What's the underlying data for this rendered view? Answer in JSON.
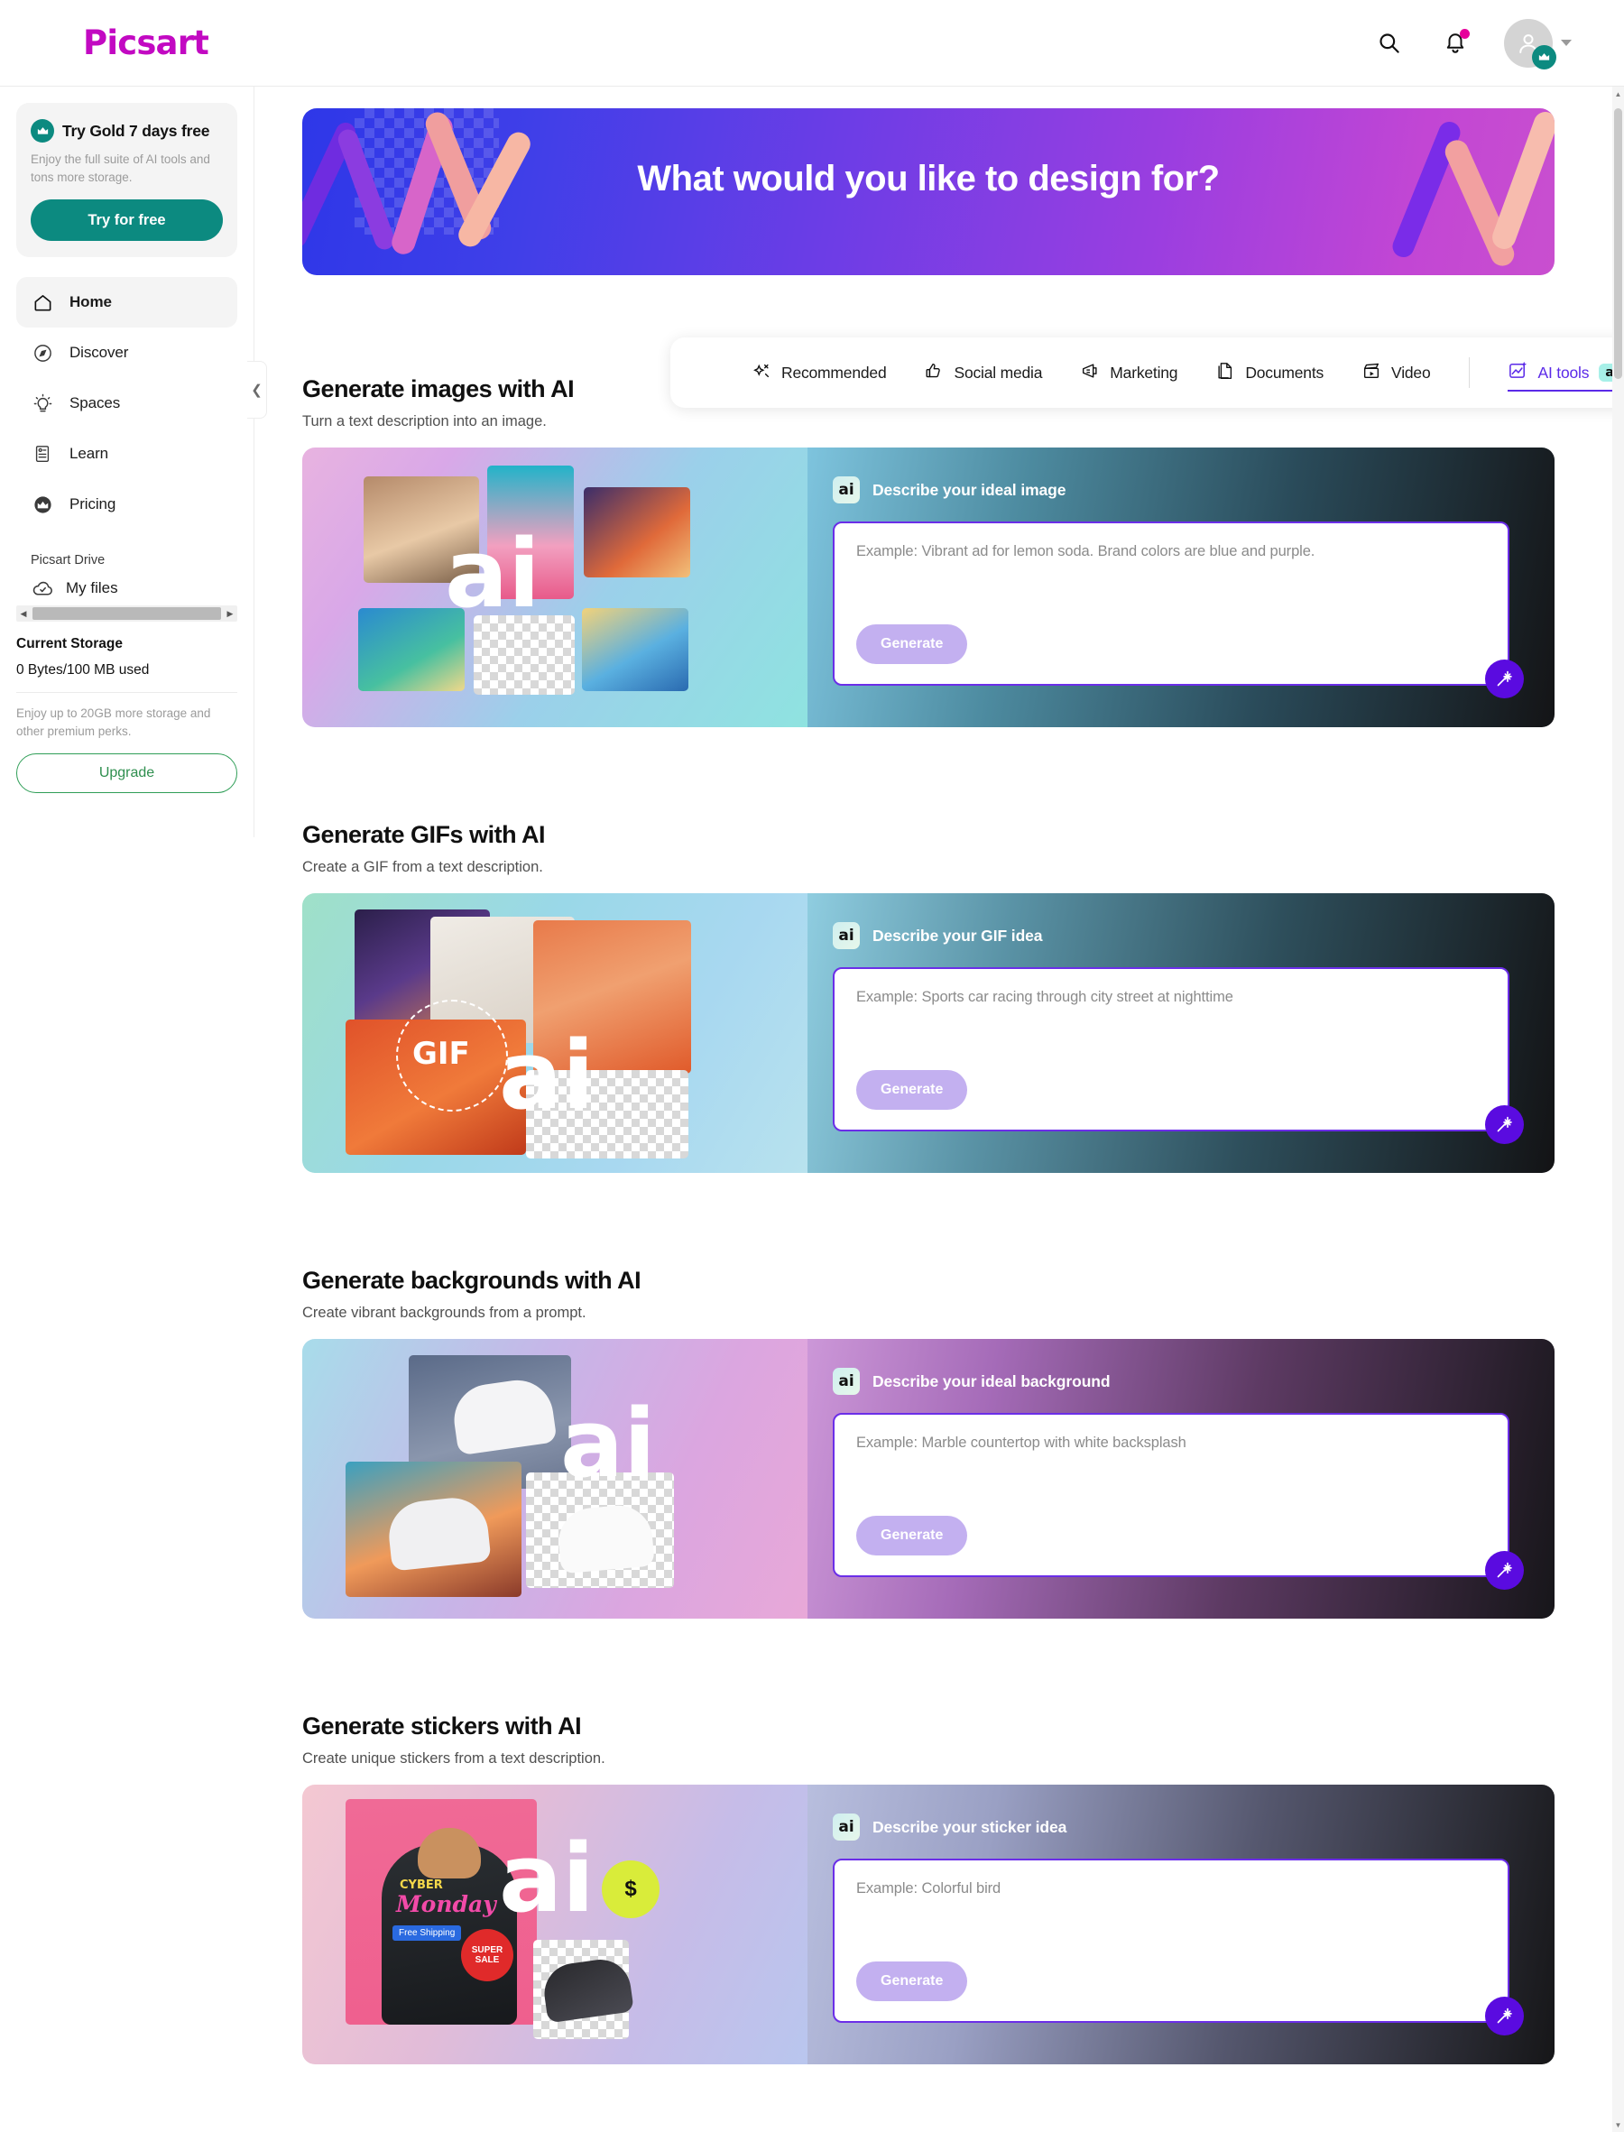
{
  "brand": {
    "name": "Picsart",
    "color": "#c209c2"
  },
  "header": {
    "search_icon": "search-icon",
    "notification_icon": "bell-icon",
    "avatar_icon": "user-avatar"
  },
  "sidebar": {
    "promo": {
      "title": "Try Gold 7 days free",
      "subtitle": "Enjoy the full suite of AI tools and tons more storage.",
      "button": "Try for free",
      "accent": "#0c8a80"
    },
    "items": [
      {
        "label": "Home",
        "icon": "home-icon",
        "active": true
      },
      {
        "label": "Discover",
        "icon": "compass-icon",
        "active": false
      },
      {
        "label": "Spaces",
        "icon": "lightbulb-icon",
        "active": false
      },
      {
        "label": "Learn",
        "icon": "book-icon",
        "active": false
      },
      {
        "label": "Pricing",
        "icon": "crown-icon",
        "active": false
      }
    ],
    "drive": {
      "label": "Picsart Drive",
      "my_files": "My files",
      "current_storage_label": "Current Storage",
      "storage_used": "0 Bytes/100 MB used",
      "perks": "Enjoy up to 20GB more storage and other premium perks.",
      "upgrade_button": "Upgrade",
      "upgrade_color": "#2f8f4f"
    },
    "collapse_icon": "chevron-left-icon"
  },
  "hero": {
    "title": "What would you like to design for?"
  },
  "tabs": [
    {
      "label": "Recommended",
      "icon": "sparkle-icon",
      "active": false
    },
    {
      "label": "Social media",
      "icon": "thumbs-up-icon",
      "active": false
    },
    {
      "label": "Marketing",
      "icon": "megaphone-icon",
      "active": false
    },
    {
      "label": "Documents",
      "icon": "document-icon",
      "active": false
    },
    {
      "label": "Video",
      "icon": "clapperboard-icon",
      "active": false
    },
    {
      "label": "AI tools",
      "icon": "ai-image-icon",
      "chip": "ai",
      "active": true
    }
  ],
  "sections": [
    {
      "title": "Generate images with AI",
      "subtitle": "Turn a text description into an image.",
      "panel_badge": "ai",
      "panel_label": "Describe your ideal image",
      "placeholder": "Example: Vibrant ad for lemon soda. Brand colors are blue and purple.",
      "generate_button": "Generate",
      "wand_icon": "magic-wand-icon",
      "art_word": "ai"
    },
    {
      "title": "Generate GIFs with AI",
      "subtitle": "Create a GIF from a text description.",
      "panel_badge": "ai",
      "panel_label": "Describe your GIF idea",
      "placeholder": "Example: Sports car racing through city street at nighttime",
      "generate_button": "Generate",
      "wand_icon": "magic-wand-icon",
      "art_word": "ai",
      "art_label": "GIF"
    },
    {
      "title": "Generate backgrounds with AI",
      "subtitle": "Create vibrant backgrounds from a prompt.",
      "panel_badge": "ai",
      "panel_label": "Describe your ideal background",
      "placeholder": "Example: Marble countertop with white backsplash",
      "generate_button": "Generate",
      "wand_icon": "magic-wand-icon",
      "art_word": "ai"
    },
    {
      "title": "Generate stickers with AI",
      "subtitle": "Create unique stickers from a text description.",
      "panel_badge": "ai",
      "panel_label": "Describe your sticker idea",
      "placeholder": "Example: Colorful bird",
      "generate_button": "Generate",
      "wand_icon": "magic-wand-icon",
      "art_word": "ai",
      "sticker_texts": {
        "cyber": "CYBER",
        "monday": "Monday",
        "shipping": "Free Shipping",
        "sale": "SUPER SALE",
        "dollar": "$"
      }
    }
  ]
}
